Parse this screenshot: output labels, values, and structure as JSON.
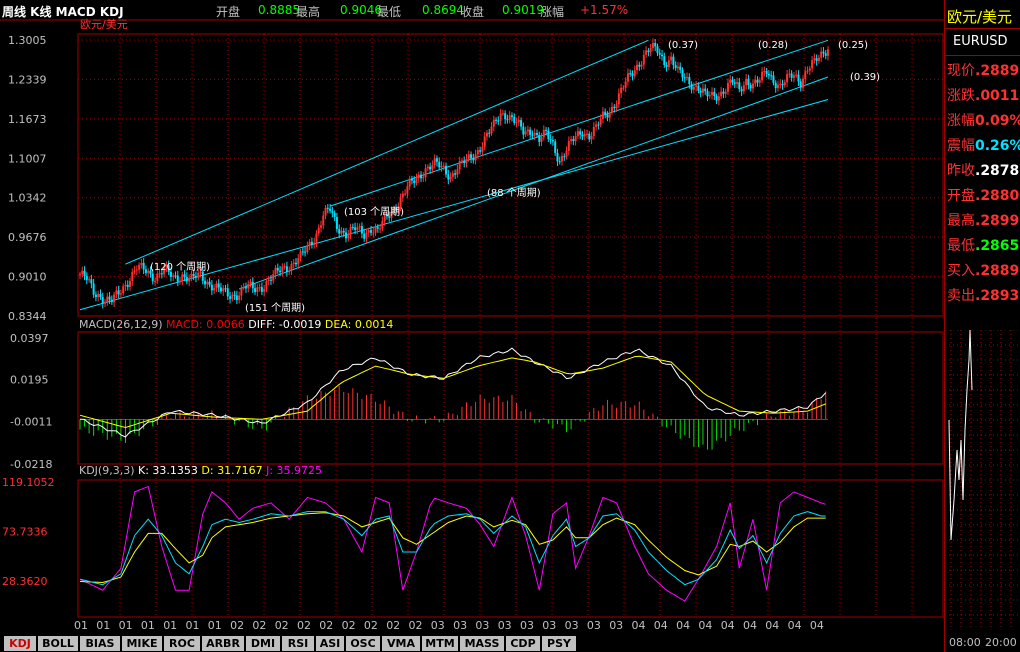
{
  "header": {
    "title": "周线 K线 MACD KDJ",
    "open_label": "开盘",
    "open_value": "0.8885",
    "high_label": "最高",
    "high_value": "0.9046",
    "low_label": "最低",
    "low_value": "0.8694",
    "close_label": "收盘",
    "close_value": "0.9019",
    "change_label": "涨幅",
    "change_value": "+1.57%"
  },
  "colors": {
    "up": "#ff3030",
    "down": "#00e0ff",
    "grid": "#a00000",
    "channel": "#00e0ff",
    "k_line": "#ffffff",
    "d_line": "#ffff00",
    "j_line": "#ff00ff"
  },
  "main_panel": {
    "symbol": "欧元/美元",
    "channel_labels": [
      "(0.37)",
      "(0.28)",
      "(0.25)",
      "(0.39)"
    ],
    "cycle_labels": [
      "120 个周期",
      "151 个周期",
      "103 个周期",
      "88 个周期"
    ]
  },
  "x_axis": {
    "labels": [
      "01",
      "01",
      "01",
      "01",
      "01",
      "01",
      "01",
      "02",
      "02",
      "02",
      "02",
      "02",
      "02",
      "02",
      "02",
      "02",
      "03",
      "03",
      "03",
      "03",
      "03",
      "03",
      "03",
      "03",
      "03",
      "04",
      "04",
      "04",
      "04",
      "04",
      "04",
      "04",
      "04",
      "04"
    ]
  },
  "right_panel": {
    "name": "欧元/美元",
    "code": "EURUSD",
    "rows": [
      {
        "label": "现价",
        "value": ".2889",
        "color": "#ff3030"
      },
      {
        "label": "涨跌",
        "value": ".0011",
        "color": "#ff3030"
      },
      {
        "label": "涨幅",
        "value": "0.09%",
        "color": "#ff3030"
      },
      {
        "label": "震幅",
        "value": "0.26%",
        "color": "#00e0ff"
      },
      {
        "label": "昨收",
        "value": ".2878",
        "color": "#ffffff"
      },
      {
        "label": "开盘",
        "value": ".2880",
        "color": "#ff3030"
      },
      {
        "label": "最高",
        "value": ".2899",
        "color": "#ff3030"
      },
      {
        "label": "最低",
        "value": ".2865",
        "color": "#00ff00"
      },
      {
        "label": "买入",
        "value": ".2889",
        "color": "#ff3030"
      },
      {
        "label": "卖出",
        "value": ".2893",
        "color": "#ff3030"
      }
    ],
    "time_labels": [
      "08:00",
      "20:00"
    ]
  },
  "tabs": [
    "KDJ",
    "BOLL",
    "BIAS",
    "MIKE",
    "ROC",
    "ARBR",
    "DMI",
    "RSI",
    "ASI",
    "OSC",
    "VMA",
    "MTM",
    "MASS",
    "CDP",
    "PSY"
  ],
  "chart_data": [
    {
      "type": "candlestick",
      "title": "欧元/美元",
      "ylim": [
        0.8344,
        1.3005
      ],
      "yticks": [
        1.3005,
        1.2339,
        1.1673,
        1.1007,
        1.0342,
        0.9676,
        0.901,
        0.8344
      ],
      "close_path": [
        [
          0,
          0.905
        ],
        [
          3,
          0.895
        ],
        [
          6,
          0.875
        ],
        [
          9,
          0.87
        ],
        [
          11,
          0.862
        ],
        [
          14,
          0.858
        ],
        [
          17,
          0.872
        ],
        [
          21,
          0.895
        ],
        [
          25,
          0.915
        ],
        [
          29,
          0.91
        ],
        [
          33,
          0.902
        ],
        [
          37,
          0.912
        ],
        [
          41,
          0.898
        ],
        [
          45,
          0.905
        ],
        [
          49,
          0.895
        ],
        [
          53,
          0.903
        ],
        [
          57,
          0.89
        ],
        [
          61,
          0.878
        ],
        [
          65,
          0.87
        ],
        [
          69,
          0.872
        ],
        [
          73,
          0.882
        ],
        [
          77,
          0.88
        ],
        [
          81,
          0.888
        ],
        [
          85,
          0.9
        ],
        [
          89,
          0.915
        ],
        [
          93,
          0.922
        ],
        [
          97,
          0.932
        ],
        [
          101,
          0.955
        ],
        [
          104,
          0.975
        ],
        [
          107,
          1.005
        ],
        [
          110,
          1.012
        ],
        [
          113,
          0.985
        ],
        [
          117,
          0.975
        ],
        [
          121,
          0.98
        ],
        [
          125,
          0.972
        ],
        [
          128,
          0.985
        ],
        [
          131,
          0.978
        ],
        [
          134,
          0.995
        ],
        [
          137,
          1.01
        ],
        [
          140,
          1.028
        ],
        [
          144,
          1.05
        ],
        [
          148,
          1.065
        ],
        [
          152,
          1.085
        ],
        [
          156,
          1.09
        ],
        [
          160,
          1.082
        ],
        [
          163,
          1.072
        ],
        [
          166,
          1.085
        ],
        [
          170,
          1.095
        ],
        [
          174,
          1.11
        ],
        [
          178,
          1.132
        ],
        [
          182,
          1.155
        ],
        [
          185,
          1.178
        ],
        [
          188,
          1.175
        ],
        [
          191,
          1.162
        ],
        [
          195,
          1.145
        ],
        [
          199,
          1.15
        ],
        [
          202,
          1.132
        ],
        [
          205,
          1.14
        ],
        [
          208,
          1.125
        ],
        [
          211,
          1.098
        ],
        [
          214,
          1.115
        ],
        [
          218,
          1.135
        ],
        [
          221,
          1.148
        ],
        [
          224,
          1.14
        ],
        [
          227,
          1.15
        ],
        [
          230,
          1.17
        ],
        [
          233,
          1.182
        ],
        [
          236,
          1.2
        ],
        [
          239,
          1.22
        ],
        [
          242,
          1.24
        ],
        [
          245,
          1.258
        ],
        [
          248,
          1.275
        ],
        [
          251,
          1.285
        ],
        [
          254,
          1.282
        ],
        [
          257,
          1.265
        ],
        [
          260,
          1.27
        ],
        [
          263,
          1.245
        ],
        [
          266,
          1.235
        ],
        [
          269,
          1.228
        ],
        [
          272,
          1.22
        ],
        [
          275,
          1.205
        ],
        [
          278,
          1.205
        ],
        [
          281,
          1.21
        ],
        [
          284,
          1.22
        ],
        [
          287,
          1.228
        ],
        [
          290,
          1.215
        ],
        [
          293,
          1.235
        ],
        [
          296,
          1.225
        ],
        [
          299,
          1.23
        ],
        [
          302,
          1.248
        ],
        [
          305,
          1.235
        ],
        [
          308,
          1.222
        ],
        [
          311,
          1.232
        ],
        [
          314,
          1.242
        ],
        [
          317,
          1.232
        ],
        [
          320,
          1.252
        ],
        [
          323,
          1.26
        ],
        [
          326,
          1.275
        ],
        [
          329,
          1.29
        ]
      ],
      "channel_annotations": [
        "(0.37)",
        "(0.28)",
        "(0.25)",
        "(0.39)"
      ],
      "cycle_annotations": [
        "120 个周期",
        "151 个周期",
        "103 个周期",
        "88 个周期"
      ]
    },
    {
      "type": "bar+line",
      "title": "MACD(26,12,9)",
      "legend": [
        {
          "name": "MACD",
          "value": "0.0066",
          "color": "#ff0000"
        },
        {
          "name": "DIFF",
          "value": "-0.0019",
          "color": "#ffffff"
        },
        {
          "name": "DEA",
          "value": "0.0014",
          "color": "#ffff00"
        }
      ],
      "header": "MACD(26,12,9)",
      "ylim": [
        -0.0218,
        0.0397
      ],
      "yticks": [
        0.0397,
        0.0195,
        -0.0011,
        -0.0218
      ],
      "diff_path": [
        [
          0,
          0.0
        ],
        [
          20,
          -0.008
        ],
        [
          40,
          0.004
        ],
        [
          60,
          0.002
        ],
        [
          80,
          -0.002
        ],
        [
          100,
          0.008
        ],
        [
          115,
          0.024
        ],
        [
          130,
          0.03
        ],
        [
          145,
          0.022
        ],
        [
          160,
          0.02
        ],
        [
          175,
          0.03
        ],
        [
          190,
          0.034
        ],
        [
          200,
          0.028
        ],
        [
          215,
          0.02
        ],
        [
          230,
          0.028
        ],
        [
          245,
          0.034
        ],
        [
          260,
          0.026
        ],
        [
          275,
          0.006
        ],
        [
          290,
          0.002
        ],
        [
          305,
          0.004
        ],
        [
          320,
          0.006
        ],
        [
          329,
          0.014
        ]
      ],
      "dea_path": [
        [
          0,
          0.002
        ],
        [
          20,
          -0.004
        ],
        [
          40,
          0.003
        ],
        [
          60,
          0.001
        ],
        [
          80,
          0.0
        ],
        [
          100,
          0.004
        ],
        [
          115,
          0.018
        ],
        [
          130,
          0.026
        ],
        [
          145,
          0.022
        ],
        [
          160,
          0.02
        ],
        [
          175,
          0.026
        ],
        [
          190,
          0.03
        ],
        [
          200,
          0.028
        ],
        [
          215,
          0.022
        ],
        [
          230,
          0.025
        ],
        [
          245,
          0.031
        ],
        [
          260,
          0.028
        ],
        [
          275,
          0.012
        ],
        [
          290,
          0.004
        ],
        [
          305,
          0.003
        ],
        [
          320,
          0.004
        ],
        [
          329,
          0.008
        ]
      ]
    },
    {
      "type": "line",
      "title": "KDJ(9,3,3)",
      "legend": [
        {
          "name": "K",
          "value": "33.1353",
          "color": "#ffffff"
        },
        {
          "name": "D",
          "value": "31.7167",
          "color": "#ffff00"
        },
        {
          "name": "J",
          "value": "35.9725",
          "color": "#ff00ff"
        }
      ],
      "header": "KDJ(9,3,3)",
      "yticks": [
        119.1052,
        73.7336,
        28.362
      ],
      "ylim": [
        0,
        119.1052
      ],
      "j_path": [
        [
          0,
          30
        ],
        [
          10,
          20
        ],
        [
          18,
          40
        ],
        [
          24,
          110
        ],
        [
          30,
          115
        ],
        [
          36,
          60
        ],
        [
          42,
          20
        ],
        [
          48,
          20
        ],
        [
          54,
          90
        ],
        [
          58,
          110
        ],
        [
          64,
          100
        ],
        [
          70,
          85
        ],
        [
          76,
          95
        ],
        [
          84,
          100
        ],
        [
          92,
          85
        ],
        [
          100,
          105
        ],
        [
          108,
          100
        ],
        [
          116,
          85
        ],
        [
          124,
          55
        ],
        [
          130,
          105
        ],
        [
          136,
          100
        ],
        [
          142,
          20
        ],
        [
          148,
          55
        ],
        [
          155,
          105
        ],
        [
          162,
          100
        ],
        [
          170,
          95
        ],
        [
          176,
          80
        ],
        [
          182,
          60
        ],
        [
          190,
          105
        ],
        [
          196,
          70
        ],
        [
          202,
          20
        ],
        [
          208,
          90
        ],
        [
          214,
          100
        ],
        [
          218,
          40
        ],
        [
          224,
          70
        ],
        [
          230,
          105
        ],
        [
          236,
          100
        ],
        [
          244,
          60
        ],
        [
          250,
          35
        ],
        [
          258,
          20
        ],
        [
          266,
          10
        ],
        [
          272,
          30
        ],
        [
          280,
          60
        ],
        [
          286,
          100
        ],
        [
          290,
          40
        ],
        [
          296,
          85
        ],
        [
          302,
          20
        ],
        [
          308,
          100
        ],
        [
          314,
          110
        ],
        [
          320,
          105
        ],
        [
          326,
          100
        ],
        [
          329,
          98
        ]
      ],
      "k_path": [
        [
          0,
          30
        ],
        [
          10,
          25
        ],
        [
          18,
          35
        ],
        [
          24,
          70
        ],
        [
          30,
          85
        ],
        [
          36,
          70
        ],
        [
          42,
          45
        ],
        [
          48,
          35
        ],
        [
          54,
          60
        ],
        [
          58,
          80
        ],
        [
          64,
          85
        ],
        [
          70,
          82
        ],
        [
          76,
          85
        ],
        [
          84,
          90
        ],
        [
          92,
          88
        ],
        [
          100,
          92
        ],
        [
          108,
          92
        ],
        [
          116,
          85
        ],
        [
          124,
          70
        ],
        [
          130,
          85
        ],
        [
          136,
          88
        ],
        [
          142,
          55
        ],
        [
          148,
          55
        ],
        [
          155,
          80
        ],
        [
          162,
          88
        ],
        [
          170,
          90
        ],
        [
          176,
          85
        ],
        [
          182,
          72
        ],
        [
          190,
          88
        ],
        [
          196,
          78
        ],
        [
          202,
          45
        ],
        [
          208,
          70
        ],
        [
          214,
          85
        ],
        [
          218,
          60
        ],
        [
          224,
          68
        ],
        [
          230,
          88
        ],
        [
          236,
          90
        ],
        [
          244,
          75
        ],
        [
          250,
          55
        ],
        [
          258,
          38
        ],
        [
          266,
          25
        ],
        [
          272,
          30
        ],
        [
          280,
          48
        ],
        [
          286,
          75
        ],
        [
          290,
          58
        ],
        [
          296,
          70
        ],
        [
          302,
          45
        ],
        [
          308,
          72
        ],
        [
          314,
          88
        ],
        [
          320,
          92
        ],
        [
          326,
          88
        ],
        [
          329,
          88
        ]
      ],
      "d_path": [
        [
          0,
          28
        ],
        [
          10,
          27
        ],
        [
          18,
          32
        ],
        [
          24,
          55
        ],
        [
          30,
          72
        ],
        [
          36,
          72
        ],
        [
          42,
          58
        ],
        [
          48,
          45
        ],
        [
          54,
          52
        ],
        [
          58,
          68
        ],
        [
          64,
          78
        ],
        [
          70,
          80
        ],
        [
          76,
          82
        ],
        [
          84,
          86
        ],
        [
          92,
          88
        ],
        [
          100,
          90
        ],
        [
          108,
          91
        ],
        [
          116,
          88
        ],
        [
          124,
          78
        ],
        [
          130,
          82
        ],
        [
          136,
          86
        ],
        [
          142,
          68
        ],
        [
          148,
          62
        ],
        [
          155,
          72
        ],
        [
          162,
          82
        ],
        [
          170,
          88
        ],
        [
          176,
          86
        ],
        [
          182,
          78
        ],
        [
          190,
          84
        ],
        [
          196,
          80
        ],
        [
          202,
          62
        ],
        [
          208,
          66
        ],
        [
          214,
          78
        ],
        [
          218,
          68
        ],
        [
          224,
          68
        ],
        [
          230,
          80
        ],
        [
          236,
          86
        ],
        [
          244,
          80
        ],
        [
          250,
          66
        ],
        [
          258,
          50
        ],
        [
          266,
          38
        ],
        [
          272,
          34
        ],
        [
          280,
          42
        ],
        [
          286,
          62
        ],
        [
          290,
          60
        ],
        [
          296,
          65
        ],
        [
          302,
          55
        ],
        [
          308,
          64
        ],
        [
          314,
          78
        ],
        [
          320,
          86
        ],
        [
          326,
          86
        ],
        [
          329,
          86
        ]
      ]
    }
  ]
}
